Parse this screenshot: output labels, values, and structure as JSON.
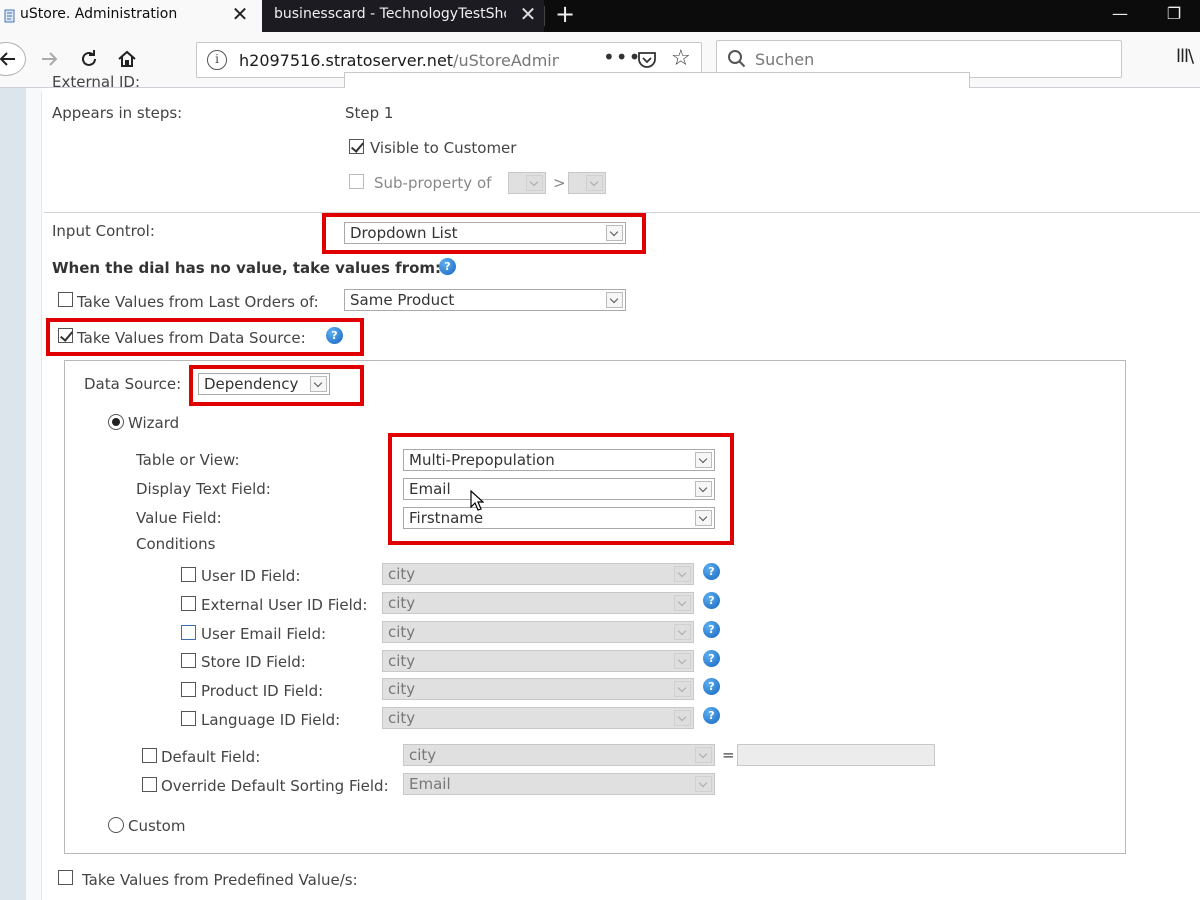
{
  "browser": {
    "tabs": [
      {
        "title": "uStore. Administration",
        "close": "✕"
      },
      {
        "title": "businesscard - TechnologyTestShop",
        "close": "✕"
      }
    ],
    "new_tab": "+",
    "window_controls": {
      "minimize": "—",
      "restore": "❐"
    },
    "url": {
      "domain": "h2097516.stratoserver.net",
      "path": "/uStoreAdmin/..."
    },
    "url_more": "•••",
    "search_placeholder": "Suchen",
    "library": "lll\\"
  },
  "form": {
    "external_id_label": "External ID:",
    "appears_in_steps_label": "Appears in steps:",
    "appears_in_steps_value": "Step 1",
    "visible_to_customer": {
      "label": "Visible to Customer",
      "checked": true
    },
    "sub_property": {
      "label": "Sub-property of",
      "separator": ">",
      "checked": false
    },
    "input_control": {
      "label": "Input Control:",
      "value": "Dropdown List"
    },
    "no_value_heading": "When the dial has no value, take values from:",
    "last_orders": {
      "label": "Take Values from Last Orders of:",
      "value": "Same Product",
      "checked": false
    },
    "data_source_toggle": {
      "label": "Take Values from Data Source:",
      "checked": true
    },
    "data_source": {
      "label": "Data Source:",
      "value": "Dependency",
      "wizard": {
        "label": "Wizard",
        "selected": true
      },
      "table_or_view": {
        "label": "Table or View:",
        "value": "Multi-Prepopulation"
      },
      "display_text_field": {
        "label": "Display Text Field:",
        "value": "Email"
      },
      "value_field": {
        "label": "Value Field:",
        "value": "Firstname"
      },
      "conditions_label": "Conditions",
      "conditions": [
        {
          "label": "User ID Field:",
          "value": "city"
        },
        {
          "label": "External User ID Field:",
          "value": "city"
        },
        {
          "label": "User Email Field:",
          "value": "city"
        },
        {
          "label": "Store ID Field:",
          "value": "city"
        },
        {
          "label": "Product ID Field:",
          "value": "city"
        },
        {
          "label": "Language ID Field:",
          "value": "city"
        }
      ],
      "default_field": {
        "label": "Default Field:",
        "value": "city",
        "equals": "="
      },
      "override_sorting": {
        "label": "Override Default Sorting Field:",
        "value": "Email"
      },
      "custom": {
        "label": "Custom",
        "selected": false
      }
    },
    "predefined_values": {
      "label": "Take Values from Predefined Value/s:",
      "checked": false
    }
  },
  "colors": {
    "highlight": "#e00000",
    "help_icon": "#1e88e5"
  }
}
